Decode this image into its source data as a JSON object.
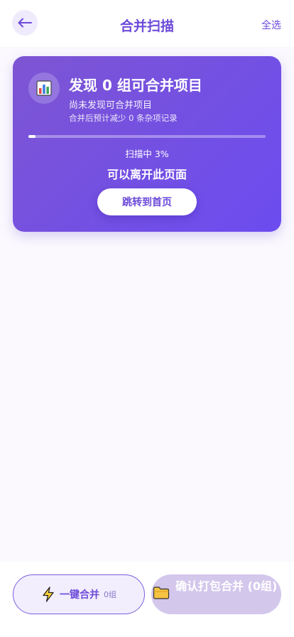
{
  "header": {
    "back_icon": "arrow-left-icon",
    "title": "合并扫描",
    "select_all": "全选"
  },
  "card": {
    "icon": "bar-chart-icon",
    "title": "发现 0 组可合并项目",
    "subtitle": "尚未发现可合并项目",
    "hint": "合并后预计减少 0 条杂项记录",
    "progress_fraction": 0.03,
    "scan_status": "扫描中 3%",
    "leave_note": "可以离开此页面",
    "home_button": "跳转到首页"
  },
  "bottom": {
    "merge_icon": "lightning-icon",
    "merge_label": "一键合并",
    "merge_count": "0组",
    "confirm_icon": "folder-icon",
    "confirm_label": "确认打包合并 (0组)"
  },
  "colors": {
    "accent": "#6c4ad9",
    "card_gradient_start": "#7d55d3",
    "card_gradient_end": "#6c4cf0",
    "disabled_button": "#d3c7ec"
  }
}
